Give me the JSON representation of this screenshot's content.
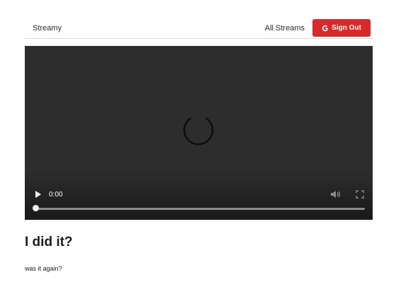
{
  "header": {
    "brand": "Streamy",
    "nav_link": "All Streams",
    "signout_label": "Sign Out",
    "signout_icon": "google-icon",
    "signout_color": "#db2828"
  },
  "video": {
    "background": "#2d2d2d",
    "loading_icon": "loading-spinner-icon",
    "play_icon": "play-icon",
    "time": "0:00",
    "mute_icon": "volume-icon",
    "fullscreen_icon": "fullscreen-icon",
    "progress": 0
  },
  "stream": {
    "title": "I did it?",
    "description": "was it again?"
  }
}
